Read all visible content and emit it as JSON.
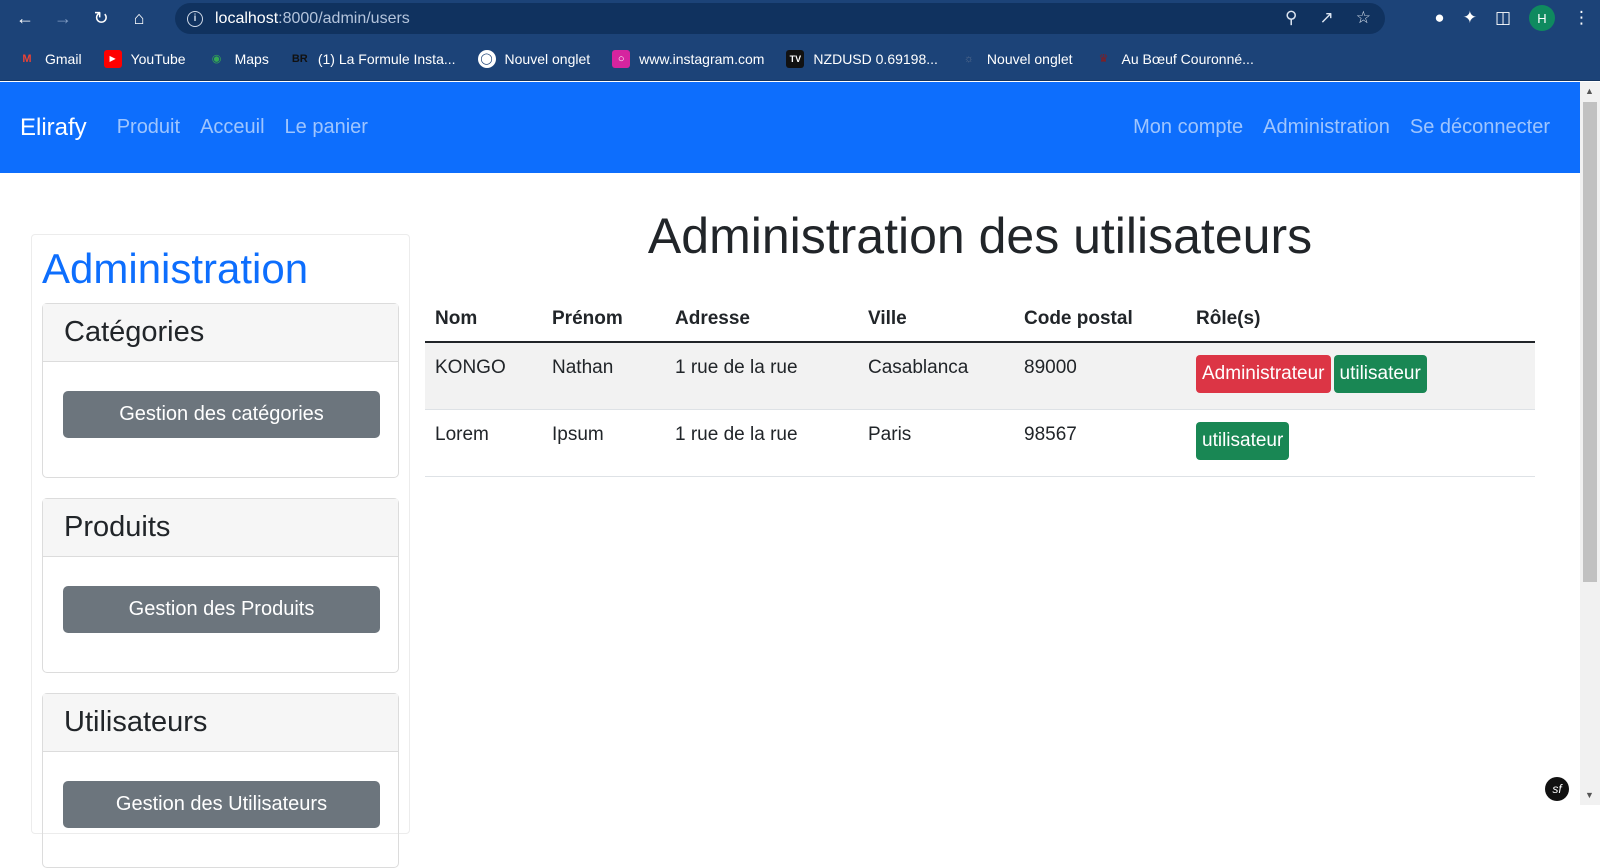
{
  "browser": {
    "url_host": "localhost",
    "url_path": ":8000/admin/users",
    "bookmarks": [
      {
        "label": "Gmail",
        "icon": "gmail-icon",
        "color": "#ea4335"
      },
      {
        "label": "YouTube",
        "icon": "youtube-icon",
        "color": "#ff0000"
      },
      {
        "label": "Maps",
        "icon": "maps-icon",
        "color": "#34a853"
      },
      {
        "label": "(1) La Formule Insta...",
        "icon": "br-icon",
        "color": "#111111"
      },
      {
        "label": "Nouvel onglet",
        "icon": "globe-icon",
        "color": "#ffffff"
      },
      {
        "label": "www.instagram.com",
        "icon": "instagram-icon",
        "color": "#d6249f"
      },
      {
        "label": "NZDUSD 0.69198...",
        "icon": "tradingview-icon",
        "color": "#111111"
      },
      {
        "label": "Nouvel onglet",
        "icon": "page-icon",
        "color": "#5a6f8f"
      },
      {
        "label": "Au Bœuf Couronné...",
        "icon": "restaurant-icon",
        "color": "#8b1a1a"
      }
    ],
    "profile_initial": "H"
  },
  "navbar": {
    "brand": "Elirafy",
    "left_links": [
      "Produit",
      "Acceuil",
      "Le panier"
    ],
    "right_links": [
      "Mon compte",
      "Administration",
      "Se déconnecter"
    ]
  },
  "sidebar": {
    "title": "Administration",
    "cards": [
      {
        "header": "Catégories",
        "button": "Gestion des catégories"
      },
      {
        "header": "Produits",
        "button": "Gestion des Produits"
      },
      {
        "header": "Utilisateurs",
        "button": "Gestion des Utilisateurs"
      }
    ]
  },
  "main": {
    "title": "Administration des utilisateurs",
    "columns": [
      "Nom",
      "Prénom",
      "Adresse",
      "Ville",
      "Code postal",
      "Rôle(s)"
    ],
    "rows": [
      {
        "nom": "KONGO",
        "prenom": "Nathan",
        "adresse": "1 rue de la rue",
        "ville": "Casablanca",
        "code_postal": "89000",
        "roles": [
          "Administrateur",
          "utilisateur"
        ]
      },
      {
        "nom": "Lorem",
        "prenom": "Ipsum",
        "adresse": "1 rue de la rue",
        "ville": "Paris",
        "code_postal": "98567",
        "roles": [
          "utilisateur"
        ]
      }
    ]
  },
  "colors": {
    "primary": "#0d6efd",
    "secondary": "#6c757d",
    "danger": "#dc3545",
    "success": "#198754",
    "chrome": "#1c4378"
  }
}
